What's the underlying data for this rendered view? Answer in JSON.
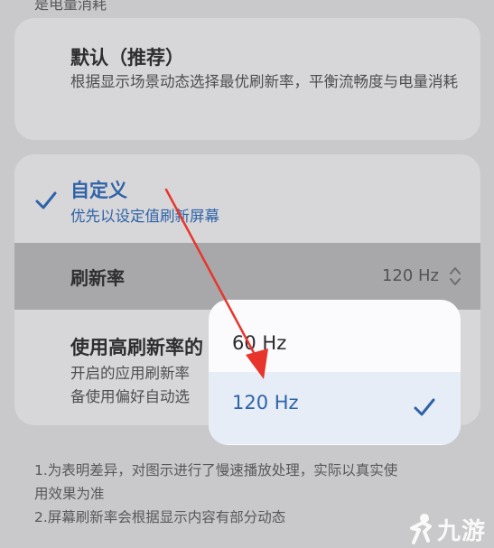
{
  "top_partial_text": "是电量消耗",
  "default_option": {
    "title": "默认（推荐）",
    "description": "根据显示场景动态选择最优刷新率，平衡流畅度与电量消耗"
  },
  "custom_option": {
    "title": "自定义",
    "subtitle": "优先以设定值刷新屏幕"
  },
  "refresh_rate": {
    "label": "刷新率",
    "value": "120 Hz"
  },
  "high_refresh": {
    "title": "使用高刷新率的",
    "desc_line1": "开启的应用刷新率",
    "desc_line2": "备使用偏好自动选"
  },
  "popup": {
    "options": [
      "60 Hz",
      "120 Hz"
    ],
    "selected": "120 Hz"
  },
  "notes": {
    "line1": "1.为表明差异，对图示进行了慢速播放处理，实际以真实使",
    "line2": "用效果为准",
    "line3": "2.屏幕刷新率会根据显示内容有部分动态"
  },
  "watermark": {
    "text": "九游"
  },
  "colors": {
    "accent": "#2f63a8",
    "annotation_arrow": "#e8352b",
    "dim_background": "#c9c9cb"
  }
}
